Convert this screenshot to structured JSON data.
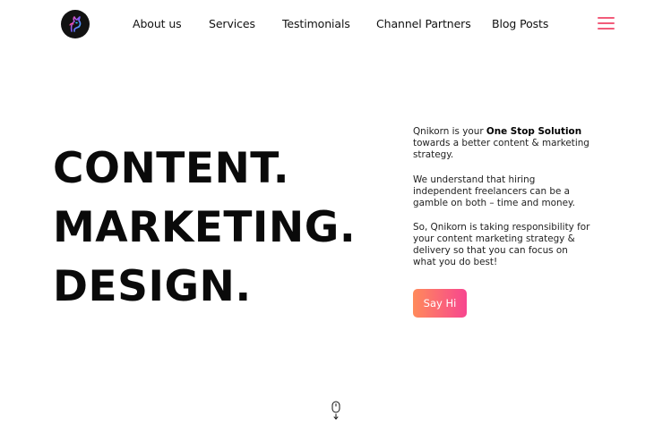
{
  "header": {
    "logo_icon": "unicorn-logo-icon",
    "nav": [
      {
        "label": "About us"
      },
      {
        "label": "Services"
      },
      {
        "label": "Testimonials"
      },
      {
        "label": "Channel Partners"
      },
      {
        "label": "Blog Posts"
      }
    ],
    "menu_icon": "hamburger-menu-icon",
    "menu_color": "#f25b7a"
  },
  "hero": {
    "headline": [
      "CONTENT.",
      "MARKETING.",
      "DESIGN."
    ],
    "intro_prefix": "Qnikorn is your ",
    "intro_bold": "One Stop Solution",
    "intro_suffix": " towards a better content & marketing strategy.",
    "paragraph2": "We understand that hiring independent freelancers can be a gamble on both – time and money.",
    "paragraph3": "So, Qnikorn is taking responsibility for your content marketing strategy & delivery so that you can focus on what you do best!",
    "cta_label": "Say Hi",
    "cta_gradient": [
      "#ff8a5b",
      "#f7468f"
    ]
  },
  "scroll_icon": "mouse-scroll-down-icon"
}
